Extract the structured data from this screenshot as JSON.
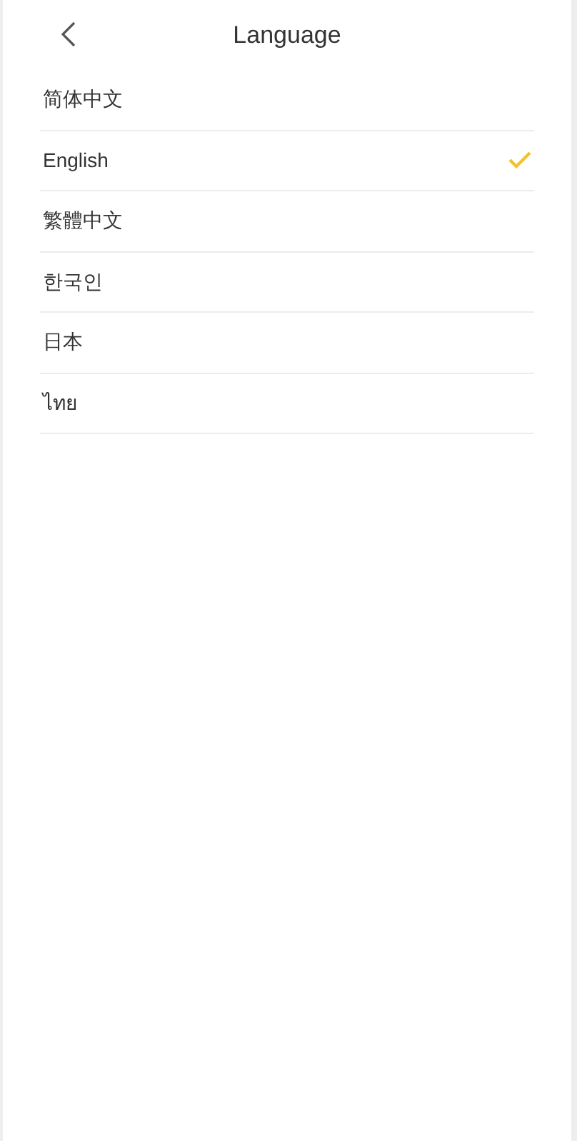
{
  "header": {
    "title": "Language"
  },
  "languages": [
    {
      "label": "简体中文",
      "selected": false
    },
    {
      "label": "English",
      "selected": true
    },
    {
      "label": "繁體中文",
      "selected": false
    },
    {
      "label": "한국인",
      "selected": false
    },
    {
      "label": "日本",
      "selected": false
    },
    {
      "label": "ไทย",
      "selected": false
    }
  ]
}
